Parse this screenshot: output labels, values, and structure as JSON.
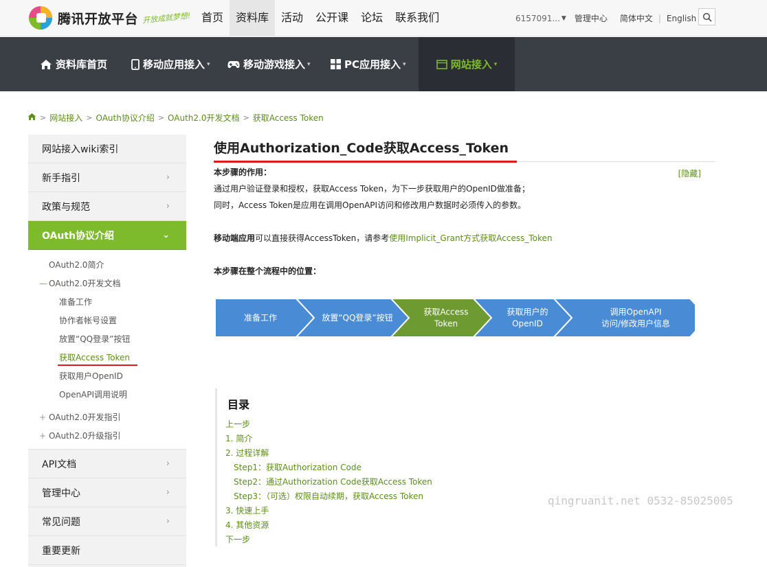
{
  "header": {
    "logo_text": "腾讯开放平台",
    "slogan": "开放成就梦想!",
    "nav": [
      "首页",
      "资料库",
      "活动",
      "公开课",
      "论坛",
      "联系我们"
    ],
    "active_nav": "资料库",
    "user_id": "6157091...",
    "links": {
      "manage": "管理中心",
      "lang_cn": "简体中文",
      "lang_en": "English"
    }
  },
  "subnav": {
    "items": [
      {
        "label": "资料库首页",
        "icon": "home-icon"
      },
      {
        "label": "移动应用接入",
        "icon": "mobile-icon"
      },
      {
        "label": "移动游戏接入",
        "icon": "gamepad-icon"
      },
      {
        "label": "PC应用接入",
        "icon": "grid-icon"
      },
      {
        "label": "网站接入",
        "icon": "browser-icon"
      }
    ],
    "active": "网站接入"
  },
  "breadcrumb": [
    "网站接入",
    "OAuth协议介绍",
    "OAuth2.0开发文档",
    "获取Access Token"
  ],
  "sidebar": {
    "top_items": [
      "网站接入wiki索引",
      "新手指引",
      "政策与规范"
    ],
    "active_item": "OAuth协议介绍",
    "sub": {
      "intro": "OAuth2.0简介",
      "dev_doc": "OAuth2.0开发文档",
      "dev_doc_children": [
        "准备工作",
        "协作者帐号设置",
        "放置“QQ登录”按钮",
        "获取Access Token",
        "获取用户OpenID",
        "OpenAPI调用说明"
      ],
      "dev_guide": "OAuth2.0开发指引",
      "upgrade_guide": "OAuth2.0升级指引"
    },
    "bottom_items": [
      "API文档",
      "管理中心",
      "常见问题",
      "重要更新"
    ]
  },
  "article": {
    "title": "使用Authorization_Code获取Access_Token",
    "hide_link": "[隐藏]",
    "purpose_label": "本步骤的作用：",
    "purpose_line1": "通过用户验证登录和授权，获取Access Token，为下一步获取用户的OpenID做准备；",
    "purpose_line2": "同时，Access Token是应用在调用OpenAPI访问和修改用户数据时必须传入的参数。",
    "mobile_bold": "移动端应用",
    "mobile_text": "可以直接获得AccessToken，请参考",
    "mobile_link": "使用Implicit_Grant方式获取Access_Token",
    "position_label": "本步骤在整个流程中的位置："
  },
  "flow": {
    "steps": [
      {
        "lines": [
          "准备工作"
        ],
        "active": false
      },
      {
        "lines": [
          "放置“QQ登录”按钮"
        ],
        "active": false
      },
      {
        "lines": [
          "获取Access",
          "Token"
        ],
        "active": true
      },
      {
        "lines": [
          "获取用户的",
          "OpenID"
        ],
        "active": false
      },
      {
        "lines": [
          "调用OpenAPI",
          "访问/修改用户信息"
        ],
        "active": false
      }
    ],
    "colors": {
      "normal": "#4a8bd6",
      "active": "#6e9a32",
      "text": "#ffffff"
    }
  },
  "toc": {
    "title": "目录",
    "items": [
      {
        "text": "上一步",
        "level": 1
      },
      {
        "text": "1. 简介",
        "level": 1
      },
      {
        "text": "2. 过程详解",
        "level": 1
      },
      {
        "text": "Step1：获取Authorization Code",
        "level": 2
      },
      {
        "text": "Step2：通过Authorization Code获取Access Token",
        "level": 2
      },
      {
        "text": "Step3：（可选）权限自动续期，获取Access Token",
        "level": 2
      },
      {
        "text": "3. 快速上手",
        "level": 1
      },
      {
        "text": "4. 其他资源",
        "level": 1
      },
      {
        "text": "下一步",
        "level": 1
      }
    ]
  },
  "watermark": "qingruanit.net 0532-85025005",
  "colors": {
    "brand_green": "#7dbb2c",
    "link_green": "#5b8e1a",
    "dark_nav": "#3a3e45",
    "accent_red": "#e2191b"
  }
}
